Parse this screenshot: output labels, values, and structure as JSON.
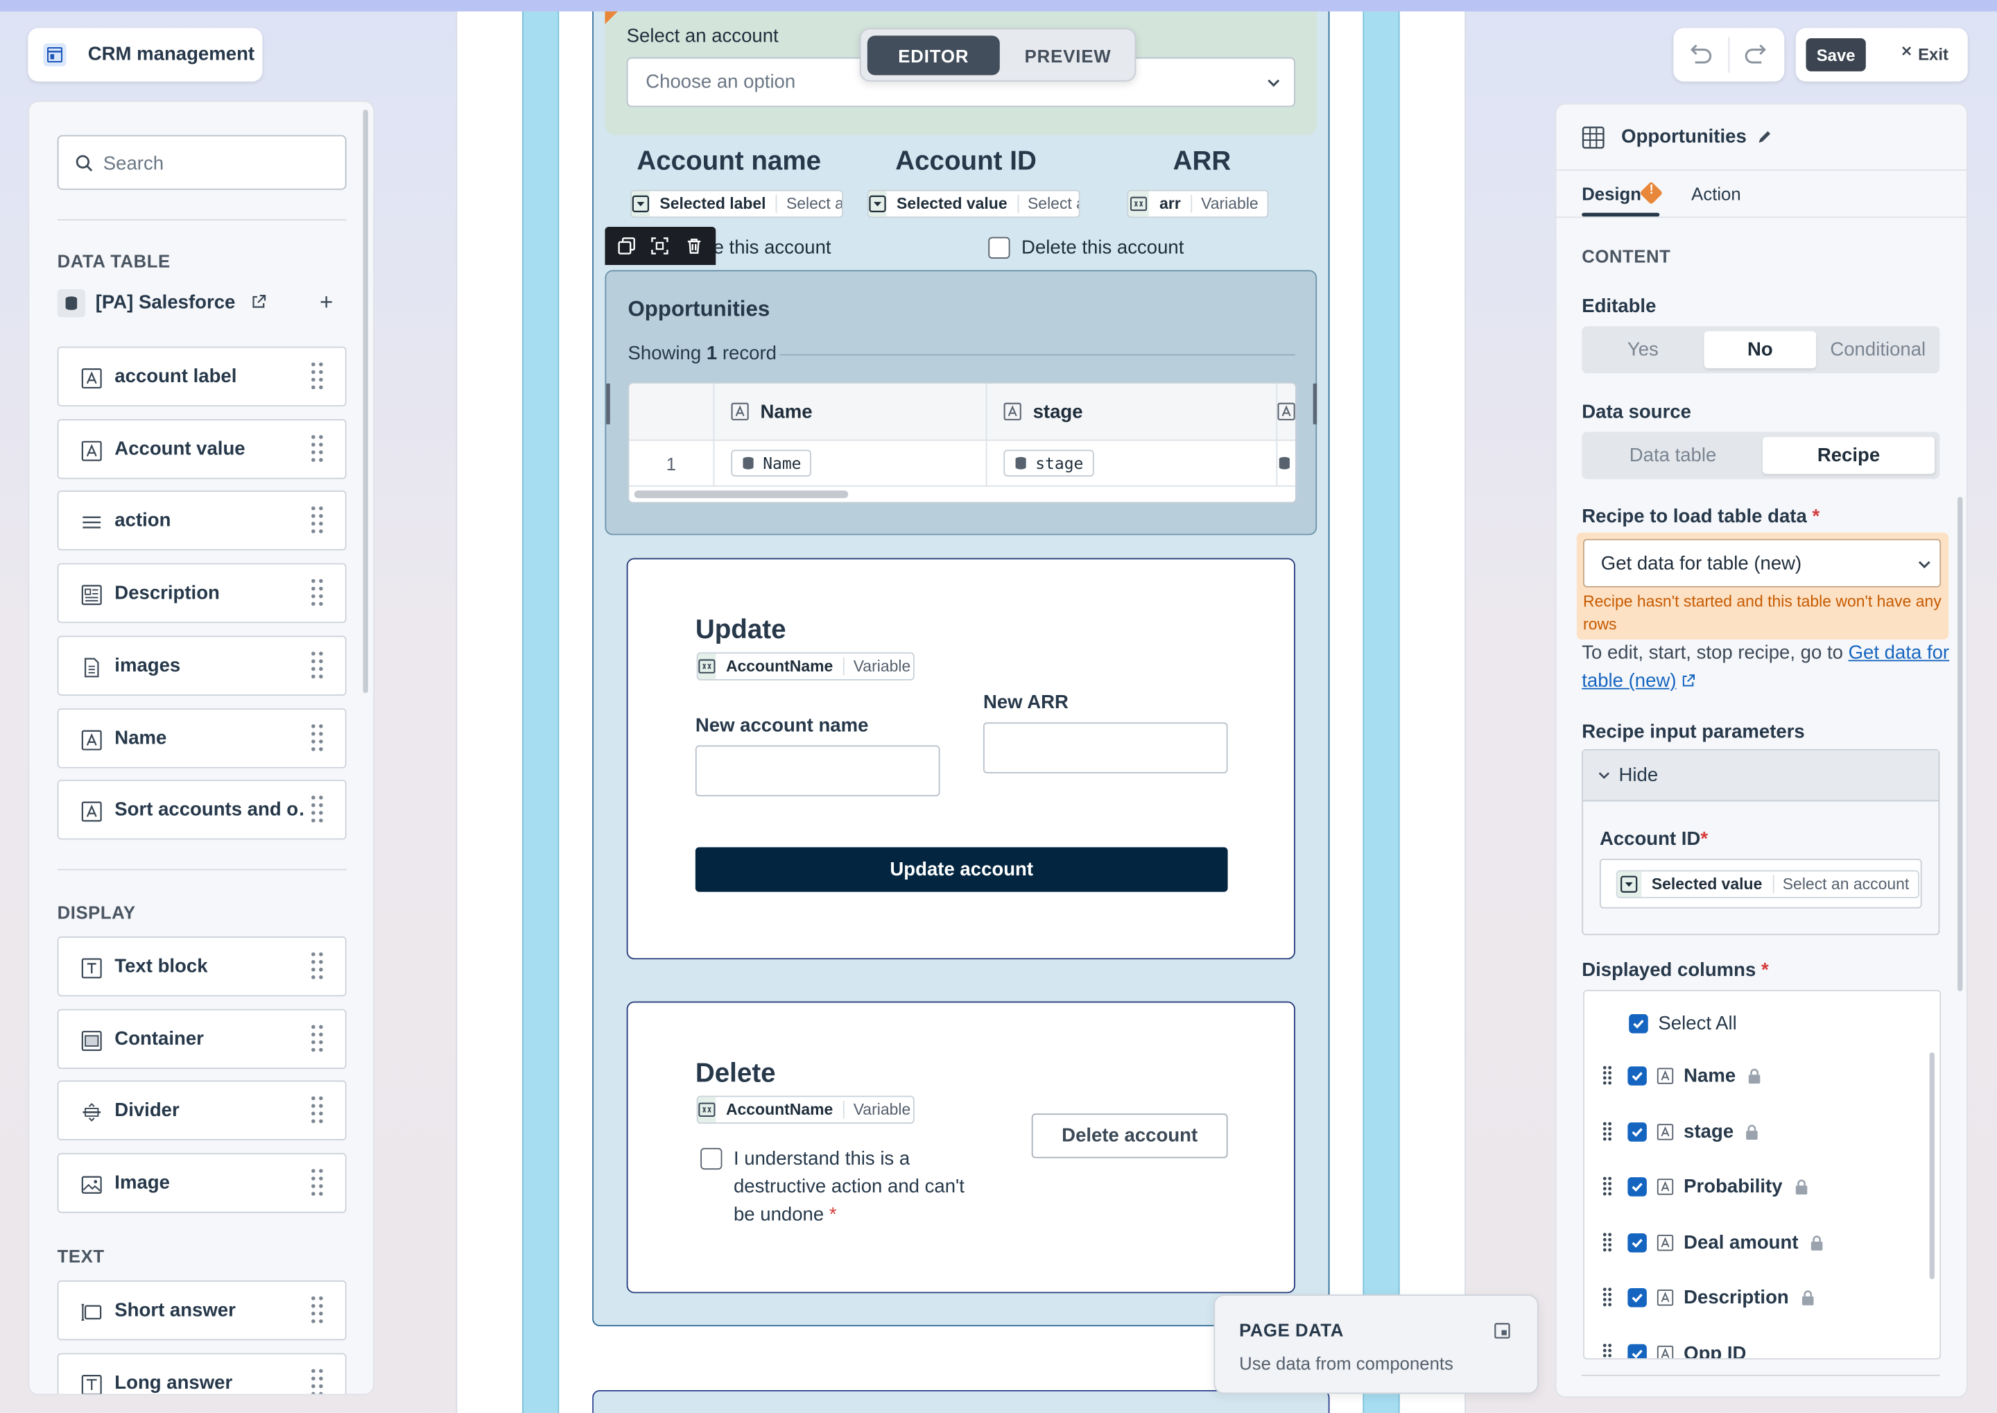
{
  "app": {
    "title": "CRM management"
  },
  "mode": {
    "editor": "EDITOR",
    "preview": "PREVIEW"
  },
  "toolbar": {
    "save": "Save",
    "exit": "Exit"
  },
  "left_panel": {
    "search_placeholder": "Search",
    "sections": {
      "data_table": "DATA TABLE",
      "display": "DISPLAY",
      "text": "TEXT"
    },
    "datasource": "[PA] Salesforce",
    "data_items": [
      {
        "label": "account label",
        "icon": "text-field-icon"
      },
      {
        "label": "Account value",
        "icon": "text-field-icon"
      },
      {
        "label": "action",
        "icon": "list-lines-icon"
      },
      {
        "label": "Description",
        "icon": "description-icon"
      },
      {
        "label": "images",
        "icon": "document-icon"
      },
      {
        "label": "Name",
        "icon": "text-field-icon"
      },
      {
        "label": "Sort accounts and o…",
        "icon": "text-field-icon"
      }
    ],
    "display_items": [
      {
        "label": "Text block",
        "icon": "text-block-icon"
      },
      {
        "label": "Container",
        "icon": "container-icon"
      },
      {
        "label": "Divider",
        "icon": "divider-icon"
      },
      {
        "label": "Image",
        "icon": "image-icon"
      }
    ],
    "text_items": [
      {
        "label": "Short answer",
        "icon": "short-answer-icon"
      },
      {
        "label": "Long answer",
        "icon": "long-answer-icon"
      }
    ]
  },
  "canvas": {
    "select_account": {
      "label": "Select an account",
      "placeholder": "Choose an option"
    },
    "fields": {
      "account_name": {
        "title": "Account name",
        "bold": "Selected label",
        "gray": "Select ar"
      },
      "account_id": {
        "title": "Account ID",
        "bold": "Selected value",
        "gray": "Select a"
      },
      "arr": {
        "title": "ARR",
        "bold": "arr",
        "gray": "Variable"
      }
    },
    "checkbox_left_visible": "e this account",
    "checkbox_right": "Delete this account",
    "opportunities": {
      "title": "Opportunities",
      "showing_pre": "Showing ",
      "showing_count": "1",
      "showing_post": " record",
      "columns": [
        "Name",
        "stage"
      ],
      "row_index": "1",
      "row_values": [
        "Name",
        "stage"
      ]
    },
    "update": {
      "title": "Update",
      "pill_bold": "AccountName",
      "pill_gray": "Variable",
      "new_name_label": "New account name",
      "new_arr_label": "New ARR",
      "button": "Update account"
    },
    "delete": {
      "title": "Delete",
      "pill_bold": "AccountName",
      "pill_gray": "Variable",
      "confirm_line1": "I understand this is a",
      "confirm_line2": "destructive action and can't",
      "confirm_line3": "be undone",
      "required_mark": "*",
      "button": "Delete account"
    },
    "page_data": {
      "title": "PAGE DATA",
      "subtitle": "Use data from components"
    }
  },
  "right_panel": {
    "title": "Opportunities",
    "tabs": {
      "design": "Design",
      "action": "Action"
    },
    "content_header": "CONTENT",
    "editable": {
      "label": "Editable",
      "options": [
        "Yes",
        "No",
        "Conditional"
      ],
      "selected": "No"
    },
    "data_source": {
      "label": "Data source",
      "options": [
        "Data table",
        "Recipe"
      ],
      "selected": "Recipe"
    },
    "recipe": {
      "label": "Recipe to load table data",
      "required_mark": "*",
      "value": "Get data for table (new)",
      "warning": "Recipe hasn't started and this table won't have any rows",
      "help_pre": "To edit, start, stop recipe, go to ",
      "help_link": "Get data for table (new)"
    },
    "params": {
      "label": "Recipe input parameters",
      "toggle": "Hide",
      "account_id_label": "Account ID",
      "pill_bold": "Selected value",
      "pill_gray": "Select an account"
    },
    "displayed_columns": {
      "label": "Displayed columns",
      "select_all": "Select All",
      "columns": [
        "Name",
        "stage",
        "Probability",
        "Deal amount",
        "Description",
        "Opp ID"
      ]
    }
  },
  "colors": {
    "accent": "#1565c0",
    "primary_button": "#042540",
    "warning_bg": "#fde1c4",
    "warning_text": "#c65a00",
    "selection": "#a6ddf1"
  }
}
